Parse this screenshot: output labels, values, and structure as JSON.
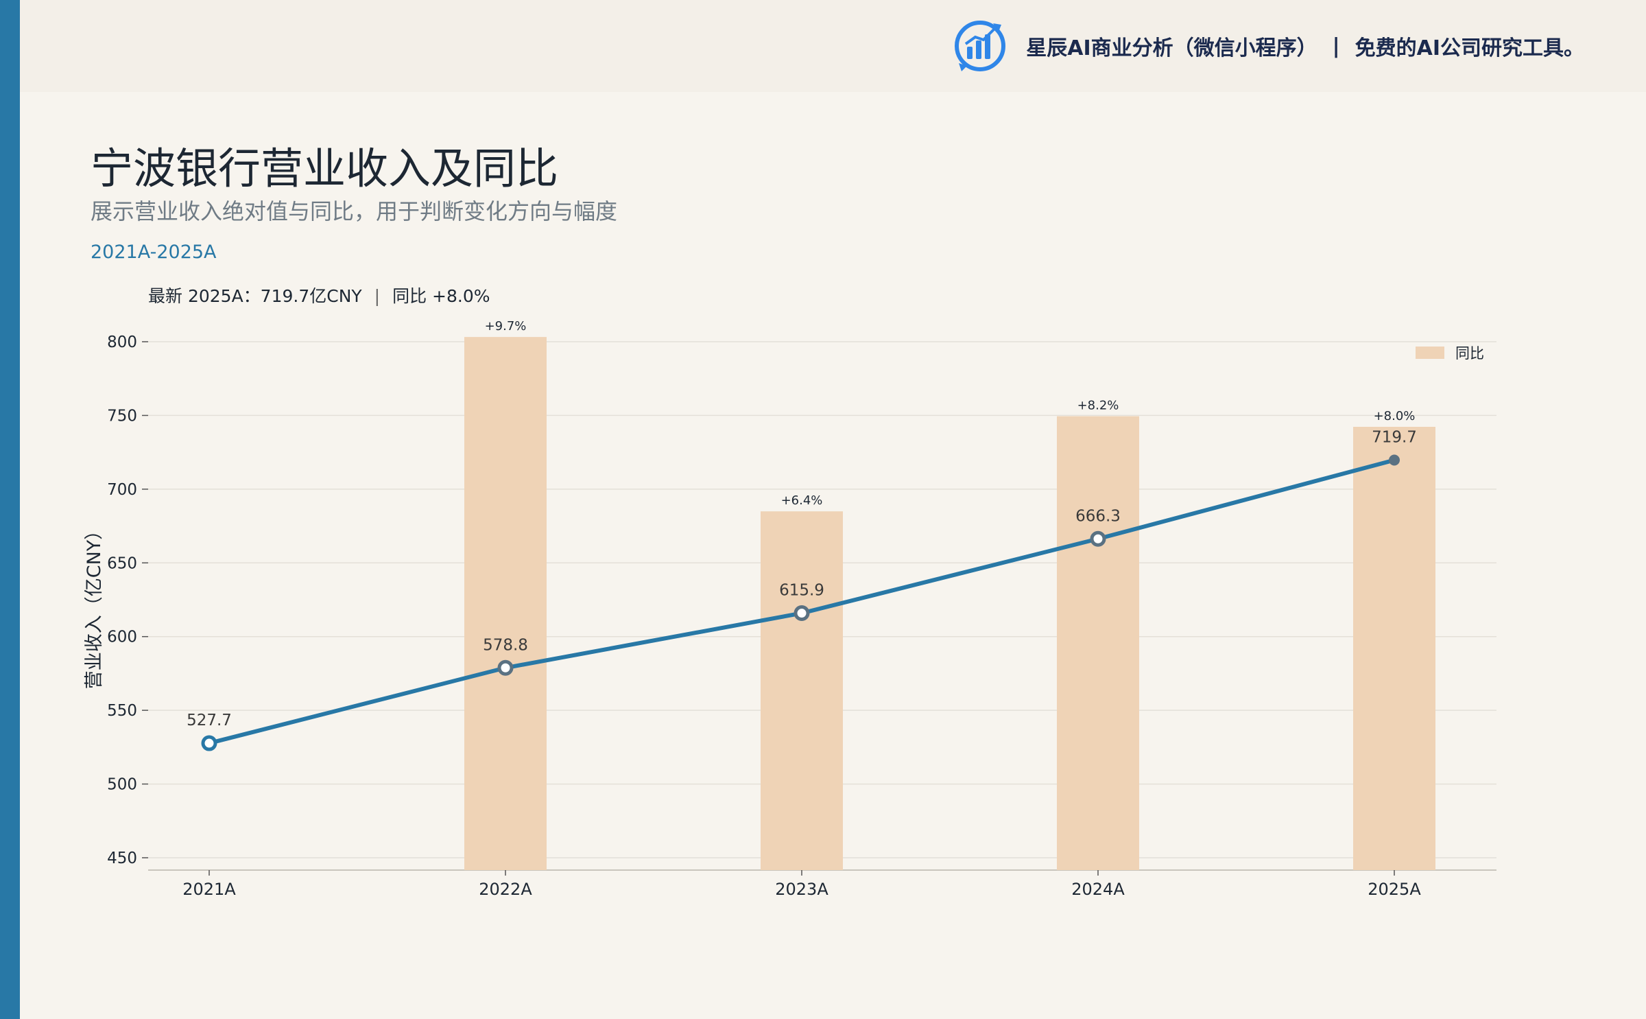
{
  "header": {
    "brand_name": "星辰AI商业分析（微信小程序）",
    "separator": "|",
    "tagline": "免费的AI公司研究工具。",
    "logo_icon": "bar-chart-logo-icon"
  },
  "title": "宁波银行营业收入及同比",
  "subtitle": "展示营业收入绝对值与同比，用于判断变化方向与幅度",
  "range_label": "2021A-2025A",
  "latest": {
    "value_text": "最新 2025A：719.7亿CNY",
    "separator": "|",
    "yoy_text": "同比 +8.0%"
  },
  "colors": {
    "accent": "#2878a6",
    "bar": "#efd3b6",
    "title": "#1d2733",
    "subtitle": "#6f7b85",
    "background": "#f7f4ee"
  },
  "chart_data": {
    "type": "bar",
    "categories": [
      "2021A",
      "2022A",
      "2023A",
      "2024A",
      "2025A"
    ],
    "ylabel": "营业收入（亿CNY）",
    "ylim": [
      450,
      800
    ],
    "yticks": [
      450,
      500,
      550,
      600,
      650,
      700,
      750,
      800
    ],
    "grid": true,
    "legend": "top-right",
    "series": [
      {
        "name": "营业收入",
        "type": "line",
        "values": [
          527.7,
          578.8,
          615.9,
          666.3,
          719.7
        ],
        "labels": [
          "527.7",
          "578.8",
          "615.9",
          "666.3",
          "719.7"
        ]
      },
      {
        "name": "同比",
        "type": "bar",
        "values": [
          null,
          9.7,
          6.4,
          8.2,
          8.0
        ],
        "labels": [
          "",
          "+9.7%",
          "+6.4%",
          "+8.2%",
          "+8.0%"
        ]
      }
    ],
    "yoy_axis_range": [
      0,
      10.0
    ]
  }
}
